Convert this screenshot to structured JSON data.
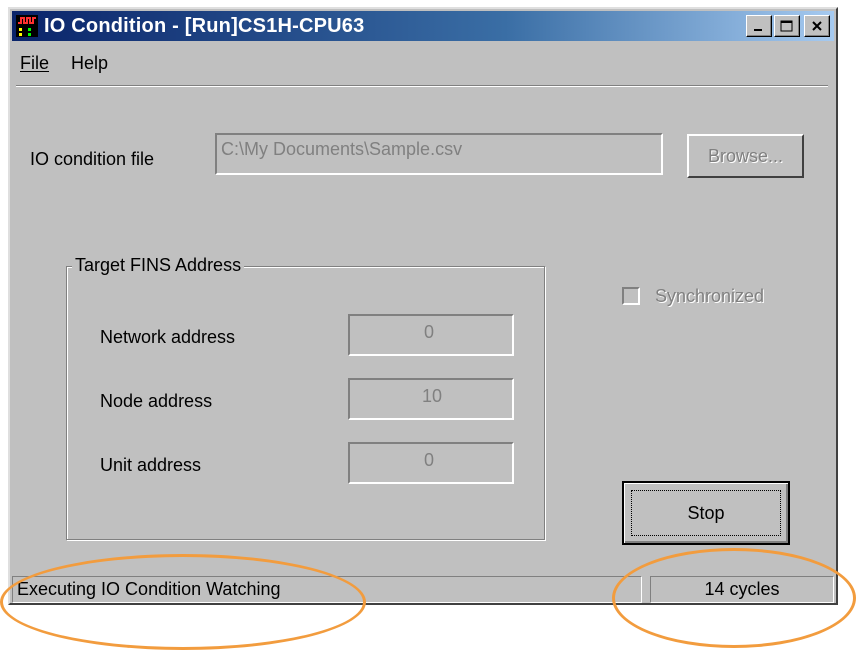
{
  "window": {
    "title": "IO Condition - [Run]CS1H-CPU63",
    "icon": "pulse-waveform-icon"
  },
  "menu": {
    "file": "File",
    "help": "Help"
  },
  "io_file": {
    "label": "IO condition file",
    "value": "C:\\My Documents\\Sample.csv",
    "browse_label": "Browse..."
  },
  "fins": {
    "group_title": "Target FINS Address",
    "network_label": "Network address",
    "network_value": "0",
    "node_label": "Node address",
    "node_value": "10",
    "unit_label": "Unit address",
    "unit_value": "0"
  },
  "synchronized": {
    "label": "Synchronized",
    "checked": false,
    "enabled": false
  },
  "stop_label": "Stop",
  "status": {
    "message": "Executing IO Condition Watching",
    "cycles": "14 cycles"
  },
  "colors": {
    "annotation": "#f29c3e",
    "title_bar": "#0a246a",
    "face": "#c0c0c0"
  }
}
